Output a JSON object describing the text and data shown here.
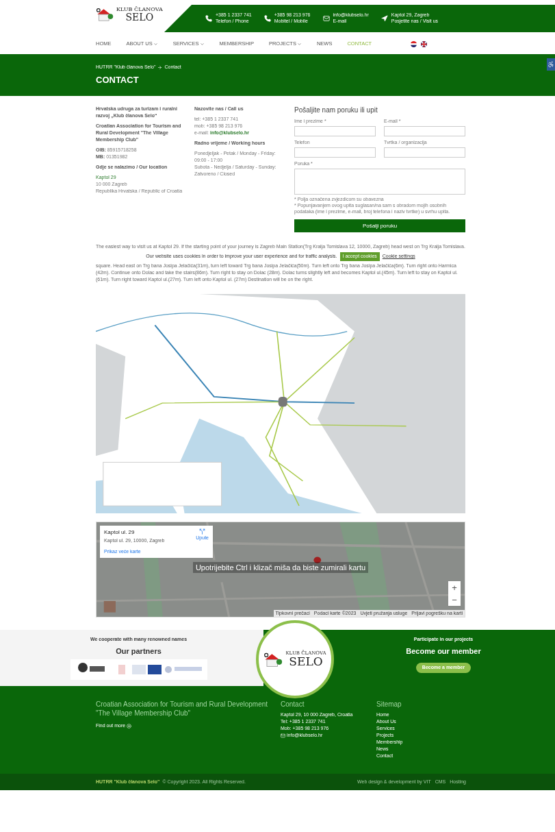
{
  "logo": {
    "line1": "KLUB ČLANOVA",
    "line2": "SELO"
  },
  "topbar": [
    {
      "kind": "phone",
      "value": "+385 1 2337 741",
      "label": "Telefon / Phone"
    },
    {
      "kind": "phone",
      "value": "+385 98 213 976",
      "label": "Mobitel / Mobile"
    },
    {
      "kind": "mail",
      "value": "info@klubselo.hr",
      "label": "E-mail"
    },
    {
      "kind": "location",
      "value": "Kaptol 29, Zagreb",
      "label": "Posjetite nas / Visit us"
    }
  ],
  "nav": [
    {
      "label": "HOME",
      "dropdown": false,
      "selected": false
    },
    {
      "label": "ABOUT US",
      "dropdown": true,
      "selected": false
    },
    {
      "label": "SERVICES",
      "dropdown": true,
      "selected": false
    },
    {
      "label": "MEMBERSHIP",
      "dropdown": false,
      "selected": false
    },
    {
      "label": "PROJECTS",
      "dropdown": true,
      "selected": false
    },
    {
      "label": "NEWS",
      "dropdown": false,
      "selected": false
    },
    {
      "label": "CONTACT",
      "dropdown": false,
      "selected": true
    }
  ],
  "languages": [
    {
      "kind": "hr"
    },
    {
      "kind": "en"
    }
  ],
  "breadcrumb": [
    "HUTRR \"Klub članova Selo\"",
    "Contact"
  ],
  "page_title": "CONTACT",
  "about": {
    "name": "Hrvatska udruga za turizam i ruralni razvoj „Klub članova Selo“",
    "name_en": "Croatian Association for Tourism and Rural Development \"The Village Membership Club\"",
    "ids": [
      "**OIB:** 85915718258",
      "**MB:** 01351982"
    ],
    "location_heading": "Gdje se nalazimo / Our location",
    "address": [
      {
        "text": "Kaptol 29",
        "link": true
      },
      {
        "text": "10 000 Zagreb",
        "link": false
      },
      {
        "text": "Republika Hrvatska / Republic of Croatia",
        "link": false
      }
    ]
  },
  "call": {
    "heading": "Nazovite nas / Call us",
    "lines": [
      "tel: +385 1 2337 741",
      "mob: +385 98 213 976",
      "e-mail: **info@klubselo.hr**"
    ]
  },
  "hours": {
    "heading": "Radno vrijeme / Working hours",
    "lines": [
      "Ponedjeljak - Petak / Monday - Friday:",
      "09:00 - 17:00",
      "Subota - Nedjelja / Saturday - Sunday:",
      "Zatvoreno / Closed"
    ]
  },
  "form": {
    "title": "Pošaljite nam poruku ili upit",
    "fields": [
      {
        "label": "Ime i prezime *",
        "kind": "input"
      },
      {
        "label": "E-mail *",
        "kind": "input"
      },
      {
        "label": "Telefon",
        "kind": "input"
      },
      {
        "label": "Tvrtka / organizacija",
        "kind": "input"
      },
      {
        "label": "Poruka *",
        "kind": "textarea"
      }
    ],
    "notes": [
      "* Polja označena zvjezdicom su obavezna",
      "* Popunjavanjem ovog upita suglasan/na sam s obradom mojih osobnih podataka (ime i prezime, e-mail, broj telefona i naziv tvrtke) u svrhu upita."
    ],
    "submit": "Pošalji poruku"
  },
  "directions": {
    "first": "The easiest way to visit us at Kaptol 29. If the starting point of your journey is Zagreb Main Station(Trg Kralja Tomislava 12, 10000, Zagreb) head west on Trg Kralja Tomislava.",
    "rest": "square. Head east on Trg bana Josipa Jelačića(31m), turn left toward Trg bana Josipa Jelačića(50m). Turn left onto Trg bana Josipa Jelačića(6m). Turn right onto Harmica (42m). Continue onto Dolac and take the stairs(86m). Turn right to stay on Dolac (28m). Dolac turns slightly left and becomes Kaptol ul.(45m). Turn left to stay on Kaptol ul.(61m). Turn right toward Kaptol ul.(27m). Turn left onto Kaptol ul. (27m) Destination will be on the right."
  },
  "cookie": {
    "text": "Our website uses cookies in order to improve your user experience and for traffic analysis.",
    "accept": "I accept cookies",
    "settings": "Cookie settings"
  },
  "travel_map": {
    "kind": "picture"
  },
  "google_map": {
    "kind": "picture",
    "place": {
      "title": "Kaptol ul. 29",
      "address": "Kaptol ul. 29, 10000, Zagreb",
      "directions": "Upute",
      "larger_map": "Prikaz veće karte"
    },
    "overlay": "Upotrijebite Ctrl i klizač miša da biste zumirali kartu",
    "zoom": [
      "+",
      "−"
    ],
    "attribution": [
      "Tipkovni prečaci",
      "Podaci karte ©2023",
      "Uvjeti pružanja usluge",
      "Prijavi pogrešku na karti"
    ]
  },
  "partners": {
    "kicker": "We cooperate with many renowned names",
    "title": "Our partners"
  },
  "badge_logo": {
    "line1": "KLUB ČLANOVA",
    "line2": "SELO"
  },
  "member": {
    "kicker": "Participate in our projects",
    "title": "Become our member",
    "button": "Become a member"
  },
  "footer": {
    "about": {
      "title": "Croatian Association for Tourism and Rural Development \"The Village Membership Club\"",
      "link": "Find out more"
    },
    "contact": {
      "title": "Contact",
      "lines": [
        {
          "kind": "text",
          "text": "Kaptol 29, 10 000 Zagreb, Croatia"
        },
        {
          "kind": "text",
          "text": "Tel: +385 1 2337 741"
        },
        {
          "kind": "text",
          "text": "Mob: +385 98 213 976"
        },
        {
          "kind": "mail",
          "text": "info@klubselo.hr"
        }
      ]
    },
    "sitemap": {
      "title": "Sitemap",
      "links": [
        "Home",
        "About Us",
        "Services",
        "Projects",
        "Membership",
        "News",
        "Contact"
      ]
    }
  },
  "bottom": {
    "owner": "HUTRR \"Klub članova Selo\"",
    "copyright": "© Copyright 2023. All Rights Reserved.",
    "credits": [
      "Web design & development by VIT",
      "CMS",
      "Hosting"
    ]
  }
}
